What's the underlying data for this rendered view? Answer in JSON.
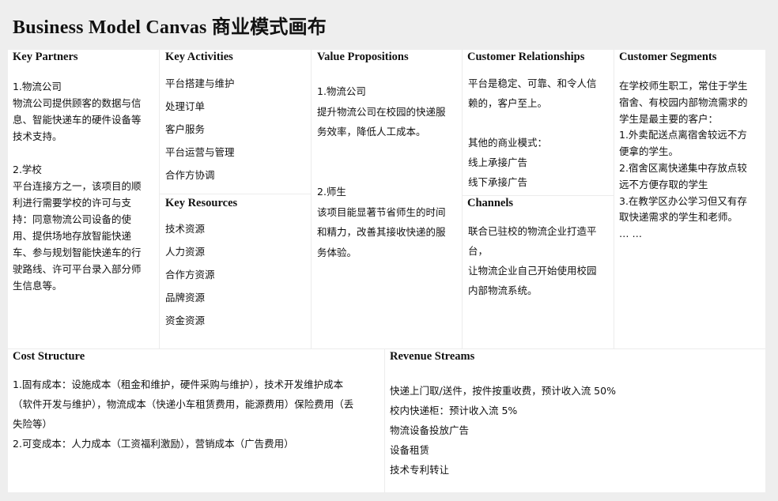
{
  "title": "Business Model Canvas 商业模式画布",
  "key_partners": {
    "heading": "Key Partners",
    "lines": [
      "1.物流公司",
      "物流公司提供顾客的数据与信",
      "息、智能快递车的硬件设备等",
      "技术支持。",
      "",
      "2.学校",
      "平台连接方之一，该项目的顺",
      "利进行需要学校的许可与支",
      "持：同意物流公司设备的使",
      "用、提供场地存放智能快递",
      "车、参与规划智能快递车的行",
      "驶路线、许可平台录入部分师",
      "生信息等。"
    ]
  },
  "key_activities": {
    "heading": "Key Activities",
    "lines": [
      "平台搭建与维护",
      "处理订单",
      "客户服务",
      "平台运营与管理",
      "合作方协调"
    ]
  },
  "key_resources": {
    "heading": "Key Resources",
    "lines": [
      "技术资源",
      "人力资源",
      "合作方资源",
      "品牌资源",
      "资金资源"
    ]
  },
  "value_propositions": {
    "heading": "Value Propositions",
    "group1": [
      "1.物流公司",
      "提升物流公司在校园的快递服",
      "务效率，降低人工成本。"
    ],
    "group2": [
      "2.师生",
      "该项目能显著节省师生的时间",
      "和精力，改善其接收快递的服",
      "务体验。"
    ]
  },
  "customer_relationships": {
    "heading": "Customer Relationships",
    "lines": [
      "平台是稳定、可靠、和令人信",
      "赖的，客户至上。",
      "",
      "其他的商业模式：",
      "线上承接广告",
      "线下承接广告"
    ]
  },
  "channels": {
    "heading": "Channels",
    "lines": [
      "联合已驻校的物流企业打造平",
      "台，",
      "让物流企业自己开始使用校园",
      "内部物流系统。"
    ]
  },
  "customer_segments": {
    "heading": "Customer Segments",
    "lines": [
      "在学校师生职工，常住于学生",
      "宿舍、有校园内部物流需求的",
      "学生是最主要的客户：",
      "1.外卖配送点离宿舍较远不方",
      "便拿的学生。",
      "2.宿舍区离快递集中存放点较",
      "远不方便存取的学生",
      "3.在教学区办公学习但又有存",
      "取快递需求的学生和老师。",
      "… …"
    ]
  },
  "cost_structure": {
    "heading": "Cost Structure",
    "lines": [
      "1.固有成本：设施成本（租金和维护，硬件采购与维护），技术开发维护成本",
      "（软件开发与维护），物流成本（快递小车租赁费用，能源费用）保险费用（丢",
      "失险等）",
      "2.可变成本：人力成本（工资福利激励），营销成本（广告费用）"
    ]
  },
  "revenue_streams": {
    "heading": "Revenue Streams",
    "lines": [
      "快递上门取/送件，按件按重收费，预计收入流 50%",
      "校内快递柜：预计收入流 5%",
      "物流设备投放广告",
      "设备租赁",
      "技术专利转让"
    ]
  }
}
